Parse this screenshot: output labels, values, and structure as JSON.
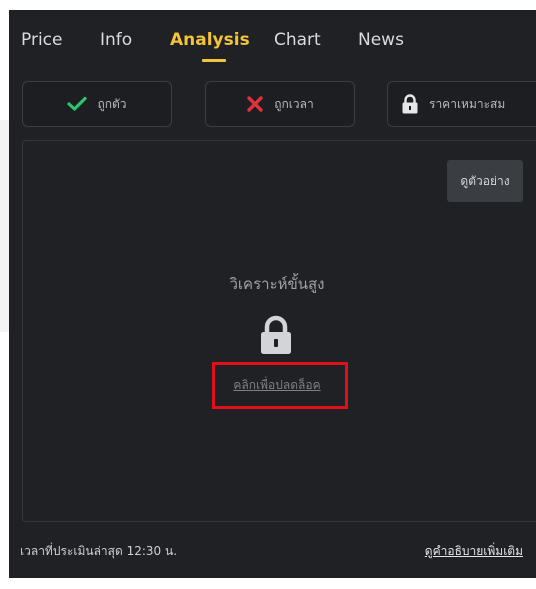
{
  "tabs": [
    {
      "label": "Price"
    },
    {
      "label": "Info"
    },
    {
      "label": "Analysis"
    },
    {
      "label": "Chart"
    },
    {
      "label": "News"
    }
  ],
  "active_tab": "Analysis",
  "tags": [
    {
      "label": "ถูกตัว",
      "icon": "check-icon",
      "color": "#2ec46b"
    },
    {
      "label": "ถูกเวลา",
      "icon": "x-icon",
      "color": "#e0313c"
    },
    {
      "label": "ราคาเหมาะสม",
      "icon": "lock-icon",
      "color": "#e6e7e9"
    }
  ],
  "panel": {
    "example_button": "ดูตัวอย่าง",
    "title": "วิเคราะห์ขั้นสูง",
    "unlock_link": "คลิกเพื่อปลดล็อค"
  },
  "footer": {
    "last_eval": "เวลาที่ประเมินล่าสุด 12:30 น.",
    "more_info": "ดูคำอธิบายเพิ่มเติม"
  },
  "colors": {
    "background": "#1f2124",
    "accent": "#f3c33a",
    "highlight": "#e10e1c"
  }
}
